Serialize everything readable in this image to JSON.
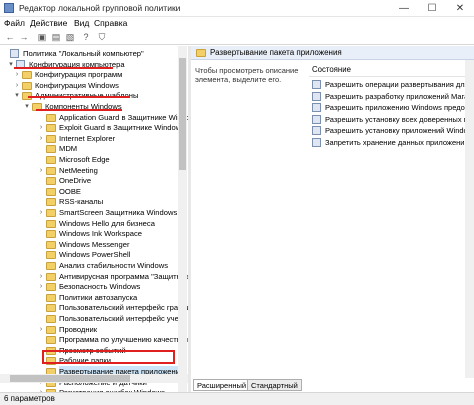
{
  "window": {
    "title": "Редактор локальной групповой политики",
    "minimize_glyph": "—",
    "maximize_glyph": "☐",
    "close_glyph": "✕"
  },
  "menu": [
    "Файл",
    "Действие",
    "Вид",
    "Справка"
  ],
  "toolbar": {
    "icons": [
      "back-arrow-icon",
      "forward-arrow-icon",
      "up-folder-icon",
      "show-hide-tree-icon",
      "export-list-icon",
      "help-icon",
      "filter-icon"
    ],
    "glyphs": [
      "←",
      "→",
      "▣",
      "▤",
      "▧",
      "?",
      "⛉"
    ]
  },
  "tree": {
    "items": [
      {
        "label": "Политика \"Локальный компьютер\"",
        "icon": "policy-computer-icon"
      },
      {
        "label": "Конфигурация компьютера",
        "icon": "computer-icon",
        "expander": "▾"
      },
      {
        "label": "Конфигурация программ",
        "icon": "folder-icon",
        "expander": "›"
      },
      {
        "label": "Конфигурация Windows",
        "icon": "folder-icon",
        "expander": "›"
      },
      {
        "label": "Административные шаблоны",
        "icon": "folder-icon",
        "expander": "▾"
      },
      {
        "label": "Компоненты Windows",
        "icon": "folder-icon",
        "expander": "▾"
      },
      {
        "label": "Application Guard в Защитнике Windo",
        "icon": "folder-icon"
      },
      {
        "label": "Exploit Guard в Защитнике Windows",
        "icon": "folder-icon",
        "expander": "›"
      },
      {
        "label": "Internet Explorer",
        "icon": "folder-icon",
        "expander": "›"
      },
      {
        "label": "MDM",
        "icon": "folder-icon"
      },
      {
        "label": "Microsoft Edge",
        "icon": "folder-icon"
      },
      {
        "label": "NetMeeting",
        "icon": "folder-icon",
        "expander": "›"
      },
      {
        "label": "OneDrive",
        "icon": "folder-icon"
      },
      {
        "label": "OOBE",
        "icon": "folder-icon"
      },
      {
        "label": "RSS-каналы",
        "icon": "folder-icon"
      },
      {
        "label": "SmartScreen Защитника Windows",
        "icon": "folder-icon",
        "expander": "›"
      },
      {
        "label": "Windows Hello для бизнеса",
        "icon": "folder-icon"
      },
      {
        "label": "Windows Ink Workspace",
        "icon": "folder-icon"
      },
      {
        "label": "Windows Messenger",
        "icon": "folder-icon"
      },
      {
        "label": "Windows PowerShell",
        "icon": "folder-icon"
      },
      {
        "label": "Анализ стабильности Windows",
        "icon": "folder-icon"
      },
      {
        "label": "Антивирусная программа \"Защитник",
        "icon": "folder-icon",
        "expander": "›"
      },
      {
        "label": "Безопасность Windows",
        "icon": "folder-icon",
        "expander": "›"
      },
      {
        "label": "Политики автозапуска",
        "icon": "folder-icon"
      },
      {
        "label": "Пользовательский интерфейс границ",
        "icon": "folder-icon"
      },
      {
        "label": "Пользовательский интерфейс учетн",
        "icon": "folder-icon"
      },
      {
        "label": "Проводник",
        "icon": "folder-icon",
        "expander": "›"
      },
      {
        "label": "Программа по улучшению качества п",
        "icon": "folder-icon"
      },
      {
        "label": "Просмотр событий",
        "icon": "folder-icon"
      },
      {
        "label": "Рабочие папки",
        "icon": "folder-icon"
      },
      {
        "label": "Развертывание пакета приложения",
        "icon": "folder-icon",
        "selected": true
      },
      {
        "label": "Расположение и датчики",
        "icon": "folder-icon",
        "expander": "›"
      },
      {
        "label": "Регистрация ошибок Windows",
        "icon": "folder-icon",
        "expander": "›"
      }
    ]
  },
  "right": {
    "header": "Развертывание пакета приложения",
    "description": "Чтобы просмотреть описание элемента, выделите его.",
    "column_header": "Состояние",
    "settings": [
      "Разрешить операции развертывания для специ",
      "Разрешить разработку приложений Магазина W",
      "Разрешить приложению Windows предоставлят",
      "Разрешить установку всех доверенных прилож",
      "Разрешить установку приложений Windows на",
      "Запретить хранение данных приложений"
    ]
  },
  "tabs": [
    "Расширенный",
    "Стандартный"
  ],
  "status": {
    "text": "6 параметров"
  },
  "colors": {
    "highlight": "#e0201f",
    "header_bg": "#e9eff8",
    "folder": "#f3cf67"
  }
}
